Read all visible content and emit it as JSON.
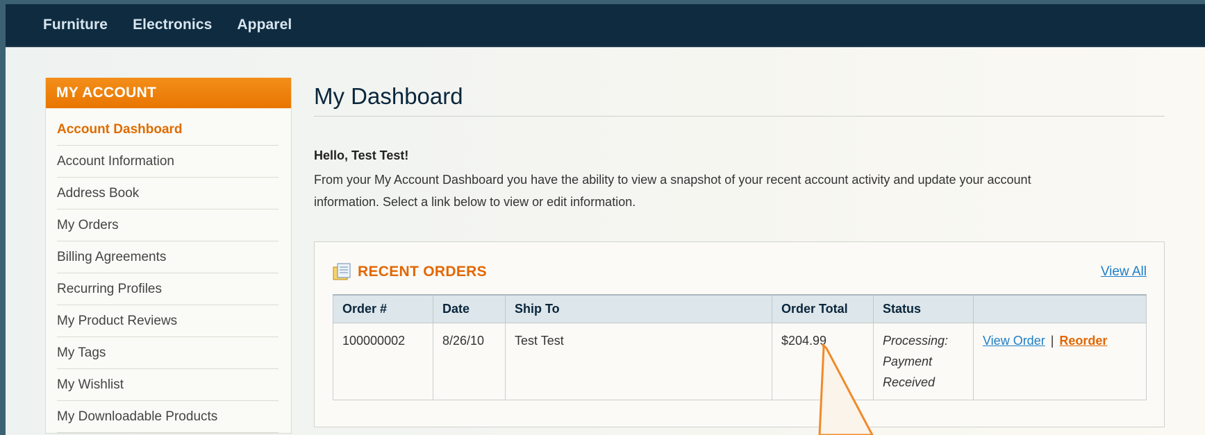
{
  "topnav": {
    "items": [
      "Furniture",
      "Electronics",
      "Apparel"
    ]
  },
  "sidebar": {
    "title": "MY ACCOUNT",
    "items": [
      {
        "label": "Account Dashboard",
        "active": true
      },
      {
        "label": "Account Information"
      },
      {
        "label": "Address Book"
      },
      {
        "label": "My Orders"
      },
      {
        "label": "Billing Agreements"
      },
      {
        "label": "Recurring Profiles"
      },
      {
        "label": "My Product Reviews"
      },
      {
        "label": "My Tags"
      },
      {
        "label": "My Wishlist"
      },
      {
        "label": "My Downloadable Products"
      }
    ]
  },
  "main": {
    "title": "My Dashboard",
    "hello": "Hello, Test Test!",
    "intro": "From your My Account Dashboard you have the ability to view a snapshot of your recent account activity and update your account information. Select a link below to view or edit information."
  },
  "recent_orders": {
    "title": "RECENT ORDERS",
    "view_all": "View All",
    "columns": [
      "Order #",
      "Date",
      "Ship To",
      "Order Total",
      "Status",
      ""
    ],
    "rows": [
      {
        "order": "100000002",
        "date": "8/26/10",
        "ship_to": "Test Test",
        "total": "$204.99",
        "status": "Processing: Payment Received",
        "view_label": "View Order",
        "sep": "|",
        "reorder_label": "Reorder"
      }
    ]
  },
  "colors": {
    "nav_bg": "#0f2b40",
    "accent_orange": "#e26703",
    "link_blue": "#1e7ec8",
    "callout": "#f08a2a"
  },
  "icons": {
    "orders": "orders-document-icon"
  }
}
